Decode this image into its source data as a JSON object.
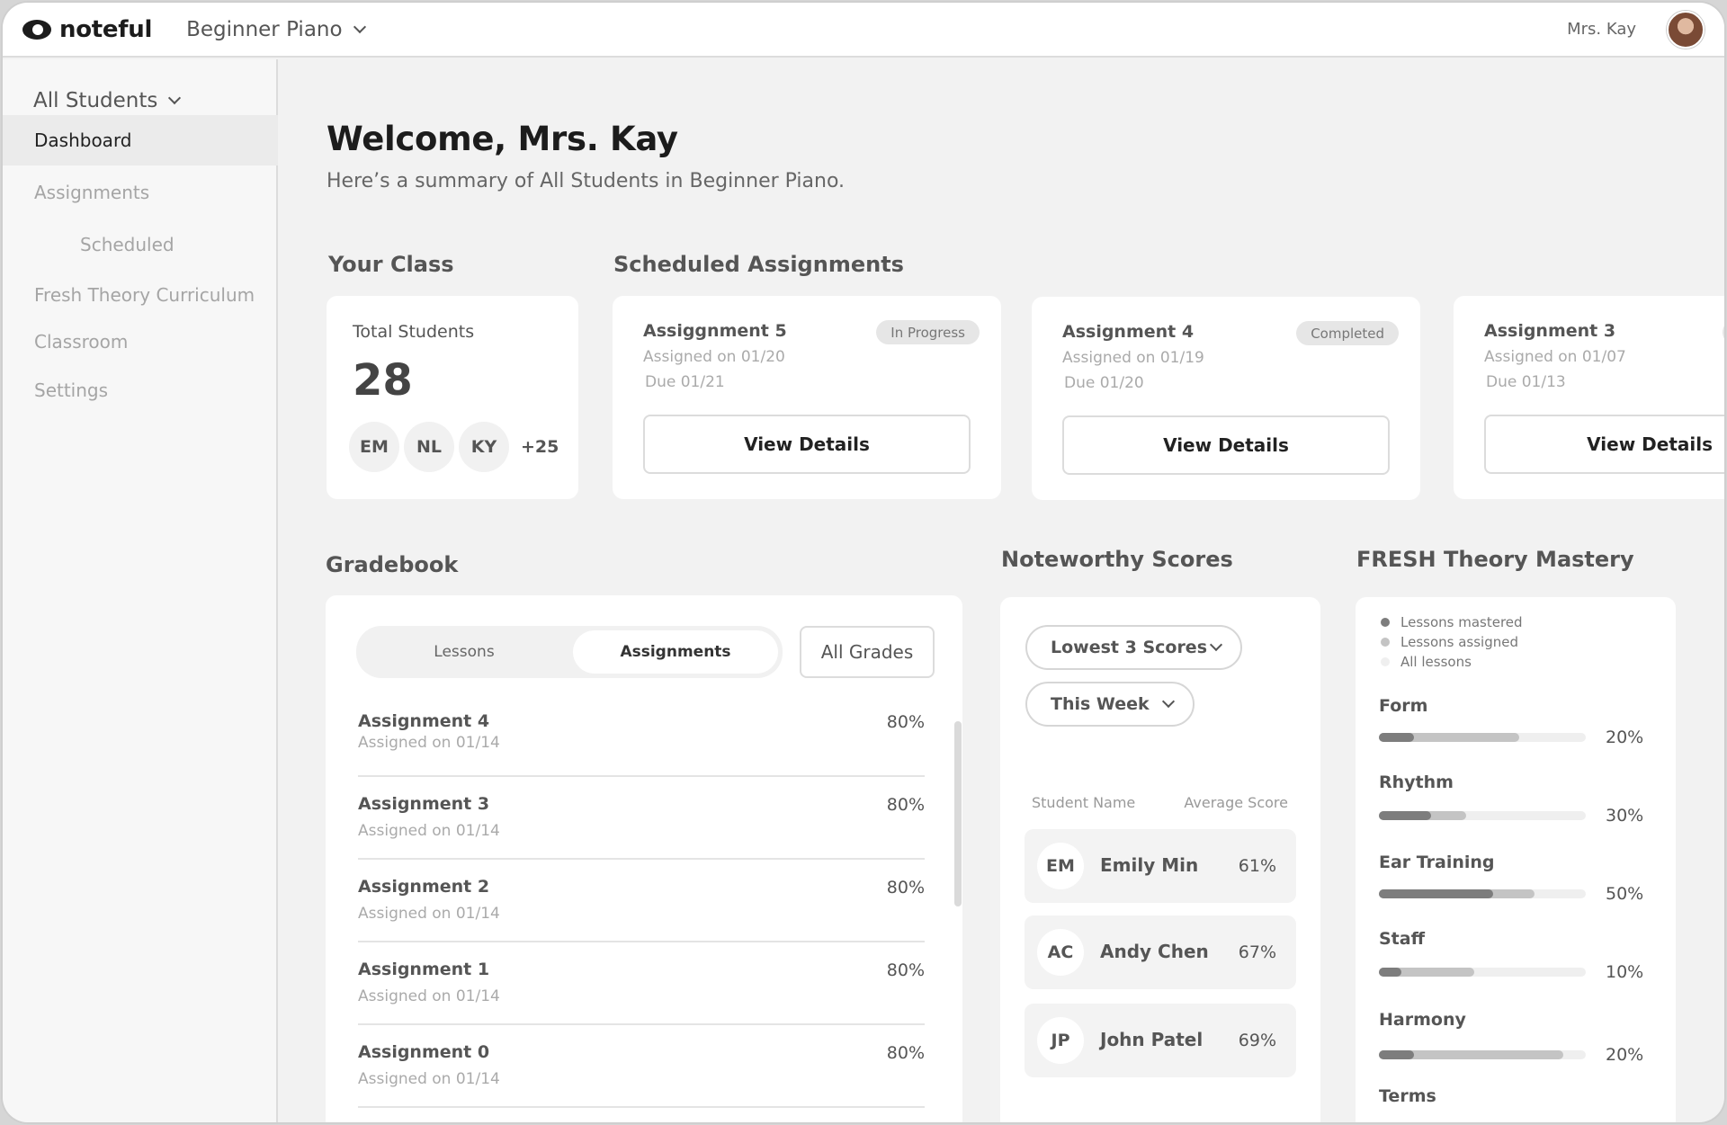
{
  "app": {
    "brand": "noteful",
    "course": "Beginner Piano",
    "teacher": "Mrs. Kay"
  },
  "sidebar": {
    "filter": "All Students",
    "items": [
      {
        "label": "Dashboard"
      },
      {
        "label": "Assignments"
      },
      {
        "label": "Scheduled"
      },
      {
        "label": "Fresh Theory Curriculum"
      },
      {
        "label": "Classroom"
      },
      {
        "label": "Settings"
      }
    ]
  },
  "main": {
    "welcome": "Welcome, Mrs. Kay",
    "summary": "Here’s a summary of All Students in Beginner Piano."
  },
  "your_class": {
    "title": "Your Class",
    "total_label": "Total Students",
    "total": "28",
    "avatars": [
      "EM",
      "NL",
      "KY"
    ],
    "more": "+25"
  },
  "scheduled": {
    "title": "Scheduled Assignments",
    "cards": [
      {
        "title": "Assiggnment 5",
        "status": "In Progress",
        "assigned": "Assigned on 01/20",
        "due": "Due 01/21",
        "button": "View Details"
      },
      {
        "title": "Assignment 4",
        "status": "Completed",
        "assigned": "Assigned on 01/19",
        "due": "Due 01/20",
        "button": "View Details"
      },
      {
        "title": "Assignment 3",
        "status": "",
        "assigned": "Assigned on 01/07",
        "due": "Due 01/13",
        "button": "View Details"
      }
    ]
  },
  "gradebook": {
    "title": "Gradebook",
    "tabs": [
      "Lessons",
      "Assignments"
    ],
    "active_tab": "Assignments",
    "grades_filter": "All Grades",
    "rows": [
      {
        "name": "Assignment 4",
        "assigned": "Assigned on 01/14",
        "score": "80%"
      },
      {
        "name": "Assignment 3",
        "assigned": "Assigned on 01/14",
        "score": "80%"
      },
      {
        "name": "Assignment 2",
        "assigned": "Assigned on 01/14",
        "score": "80%"
      },
      {
        "name": "Assignment 1",
        "assigned": "Assigned on 01/14",
        "score": "80%"
      },
      {
        "name": "Assignment 0",
        "assigned": "Assigned on 01/14",
        "score": "80%"
      }
    ]
  },
  "noteworthy": {
    "title": "Noteworthy Scores",
    "score_filter": "Lowest 3 Scores",
    "period_filter": "This Week",
    "col_name": "Student Name",
    "col_score": "Average Score",
    "students": [
      {
        "initials": "EM",
        "name": "Emily Min",
        "score": "61%"
      },
      {
        "initials": "AC",
        "name": "Andy Chen",
        "score": "67%"
      },
      {
        "initials": "JP",
        "name": "John Patel",
        "score": "69%"
      }
    ]
  },
  "mastery": {
    "title": "FRESH Theory Mastery",
    "legend": [
      "Lessons mastered",
      "Lessons assigned",
      "All lessons"
    ],
    "colors": {
      "mastered": "#7d7d7d",
      "assigned": "#c4c4c4",
      "all": "#efefef"
    },
    "topics": [
      {
        "name": "Form",
        "pct": "20%",
        "mastered": 0.17,
        "assigned": 0.68
      },
      {
        "name": "Rhythm",
        "pct": "30%",
        "mastered": 0.25,
        "assigned": 0.42
      },
      {
        "name": "Ear Training",
        "pct": "50%",
        "mastered": 0.55,
        "assigned": 0.75
      },
      {
        "name": "Staff",
        "pct": "10%",
        "mastered": 0.11,
        "assigned": 0.46
      },
      {
        "name": "Harmony",
        "pct": "20%",
        "mastered": 0.17,
        "assigned": 0.89
      },
      {
        "name": "Terms",
        "pct": "",
        "mastered": 0,
        "assigned": 0
      }
    ]
  }
}
